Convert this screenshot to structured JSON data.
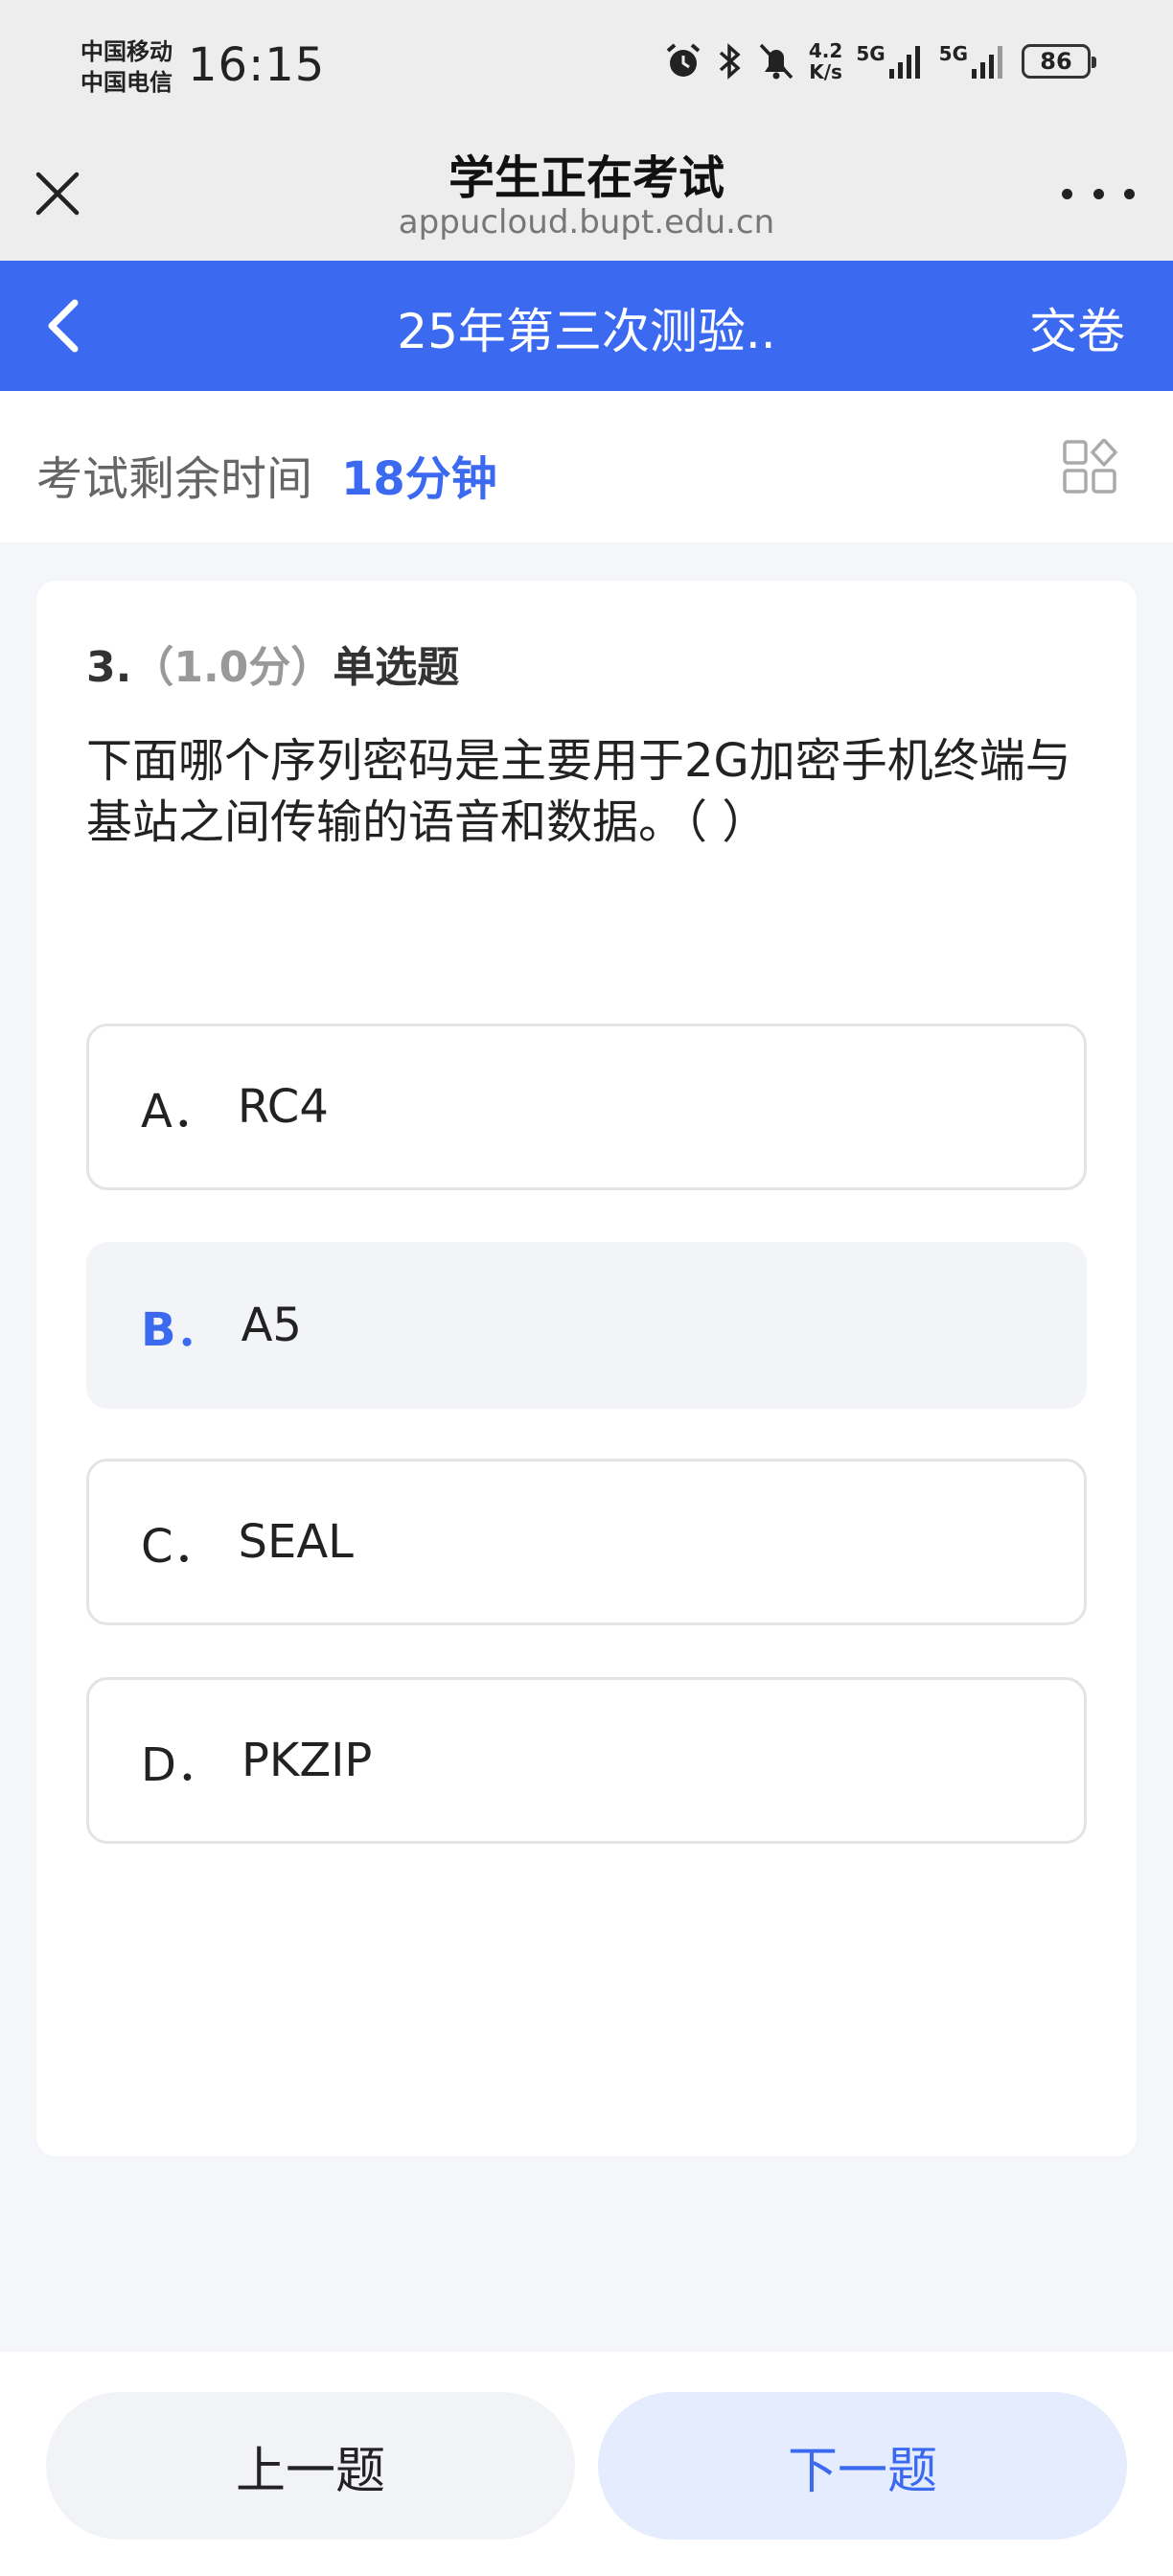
{
  "status_bar": {
    "carrier_1": "中国移动",
    "carrier_2": "中国电信",
    "time": "16:15",
    "net_speed_value": "4.2",
    "net_speed_unit": "K/s",
    "network_1": "5G",
    "network_2": "5G",
    "battery": "86",
    "icons": [
      "alarm-icon",
      "bluetooth-icon",
      "mute-icon",
      "signal-icon",
      "signal-icon",
      "battery-icon"
    ]
  },
  "browser": {
    "title": "学生正在考试",
    "url": "appucloud.bupt.edu.cn"
  },
  "header": {
    "title": "25年第三次测验..",
    "submit_label": "交卷",
    "accent_color": "#3b6af0"
  },
  "timer": {
    "label": "考试剩余时间",
    "value": "18分钟"
  },
  "question": {
    "number": "3.",
    "score": "（1.0分）",
    "type": "单选题",
    "text": "下面哪个序列密码是主要用于2G加密手机终端与基站之间传输的语音和数据。（ ）",
    "options": [
      {
        "letter": "A．",
        "text": "RC4",
        "selected": false
      },
      {
        "letter": "B．",
        "text": "A5",
        "selected": true
      },
      {
        "letter": "C．",
        "text": "SEAL",
        "selected": false
      },
      {
        "letter": "D．",
        "text": "PKZIP",
        "selected": false
      }
    ]
  },
  "nav": {
    "prev_label": "上一题",
    "next_label": "下一题"
  }
}
